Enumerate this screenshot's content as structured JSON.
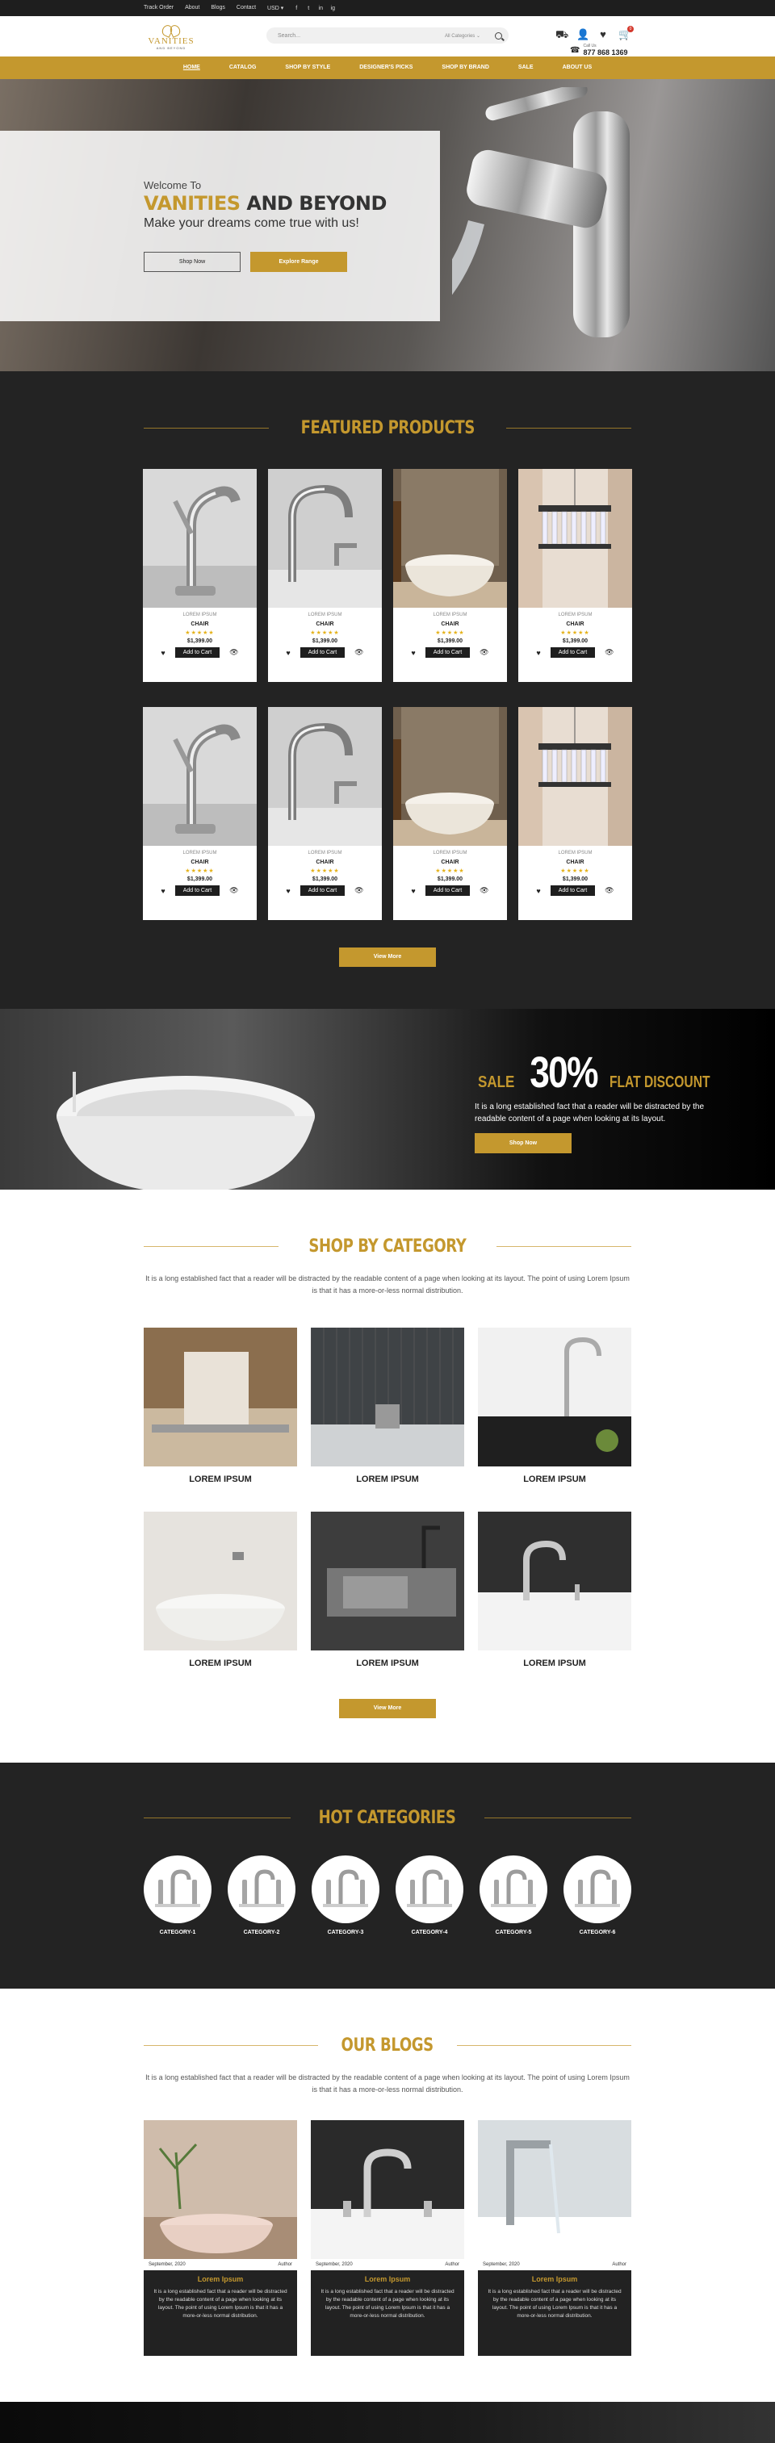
{
  "topbar": {
    "links": [
      "Track Order",
      "About",
      "Blogs",
      "Contact",
      "USD ▾"
    ],
    "social": [
      "f",
      "t",
      "in",
      "ig"
    ]
  },
  "header": {
    "logo_name": "VANITIES",
    "logo_sub": "AND BEYOND",
    "search_placeholder": "Search...",
    "search_category": "All Categories ⌄",
    "call_label": "Call Us",
    "phone": "877 868 1369"
  },
  "nav": [
    "Home",
    "Catalog",
    "Shop by Style",
    "Designer's Picks",
    "Shop by Brand",
    "Sale",
    "About Us"
  ],
  "hero": {
    "welcome": "Welcome To",
    "title_gold": "VANITIES",
    "title_dark": " AND BEYOND",
    "tagline": "Make your dreams come true with us!",
    "btn_shop": "Shop Now",
    "btn_explore": "Explore Range"
  },
  "featured": {
    "heading": "Featured Products",
    "products": [
      {
        "lorem": "LOREM IPSUM",
        "title": "CHAIR",
        "price": "$1,399.00",
        "img": "faucet1"
      },
      {
        "lorem": "LOREM IPSUM",
        "title": "CHAIR",
        "price": "$1,399.00",
        "img": "faucet2"
      },
      {
        "lorem": "LOREM IPSUM",
        "title": "CHAIR",
        "price": "$1,399.00",
        "img": "bath"
      },
      {
        "lorem": "LOREM IPSUM",
        "title": "CHAIR",
        "price": "$1,399.00",
        "img": "chandelier"
      },
      {
        "lorem": "LOREM IPSUM",
        "title": "CHAIR",
        "price": "$1,399.00",
        "img": "faucet1"
      },
      {
        "lorem": "LOREM IPSUM",
        "title": "CHAIR",
        "price": "$1,399.00",
        "img": "faucet2"
      },
      {
        "lorem": "LOREM IPSUM",
        "title": "CHAIR",
        "price": "$1,399.00",
        "img": "bath"
      },
      {
        "lorem": "LOREM IPSUM",
        "title": "CHAIR",
        "price": "$1,399.00",
        "img": "chandelier"
      }
    ],
    "add_label": "Add to Cart",
    "stars": "★★★★★",
    "view_more": "View More"
  },
  "discount": {
    "sale": "SALE",
    "pct": "30%",
    "flat": "FLAT DISCOUNT",
    "desc": "It is a long established fact that a reader will be distracted by the readable content of a page when looking at its layout.",
    "btn": "Shop Now"
  },
  "shopcat": {
    "heading": "Shop By Category",
    "intro": "It is a long established fact that a reader will be distracted by the readable content of a page when looking at its layout. The point of using Lorem Ipsum is that it has a more-or-less normal distribution.",
    "items": [
      "LOREM IPSUM",
      "LOREM IPSUM",
      "LOREM IPSUM",
      "LOREM IPSUM",
      "LOREM IPSUM",
      "LOREM IPSUM"
    ],
    "view_more": "View More"
  },
  "hotcat": {
    "heading": "Hot Categories",
    "items": [
      "CATEGORY-1",
      "CATEGORY-2",
      "CATEGORY-3",
      "CATEGORY-4",
      "CATEGORY-5",
      "CATEGORY-6"
    ]
  },
  "blogs": {
    "heading": "Our Blogs",
    "intro": "It is a long established fact that a reader will be distracted by the readable content of a page when looking at its layout. The point of using Lorem Ipsum is that it has a more-or-less normal distribution.",
    "posts": [
      {
        "date": "September, 2020",
        "author": "Author",
        "title": "Lorem Ipsum",
        "desc": "It is a long established fact that a reader will be distracted by the readable content of a page when looking at its layout. The point of using Lorem Ipsum is that it has a more-or-less normal distribution."
      },
      {
        "date": "September, 2020",
        "author": "Author",
        "title": "Lorem Ipsum",
        "desc": "It is a long established fact that a reader will be distracted by the readable content of a page when looking at its layout. The point of using Lorem Ipsum is that it has a more-or-less normal distribution."
      },
      {
        "date": "September, 2020",
        "author": "Author",
        "title": "Lorem Ipsum",
        "desc": "It is a long established fact that a reader will be distracted by the readable content of a page when looking at its layout. The point of using Lorem Ipsum is that it has a more-or-less normal distribution."
      }
    ]
  },
  "colors": {
    "accent": "#c4982e",
    "dark": "#232323"
  }
}
